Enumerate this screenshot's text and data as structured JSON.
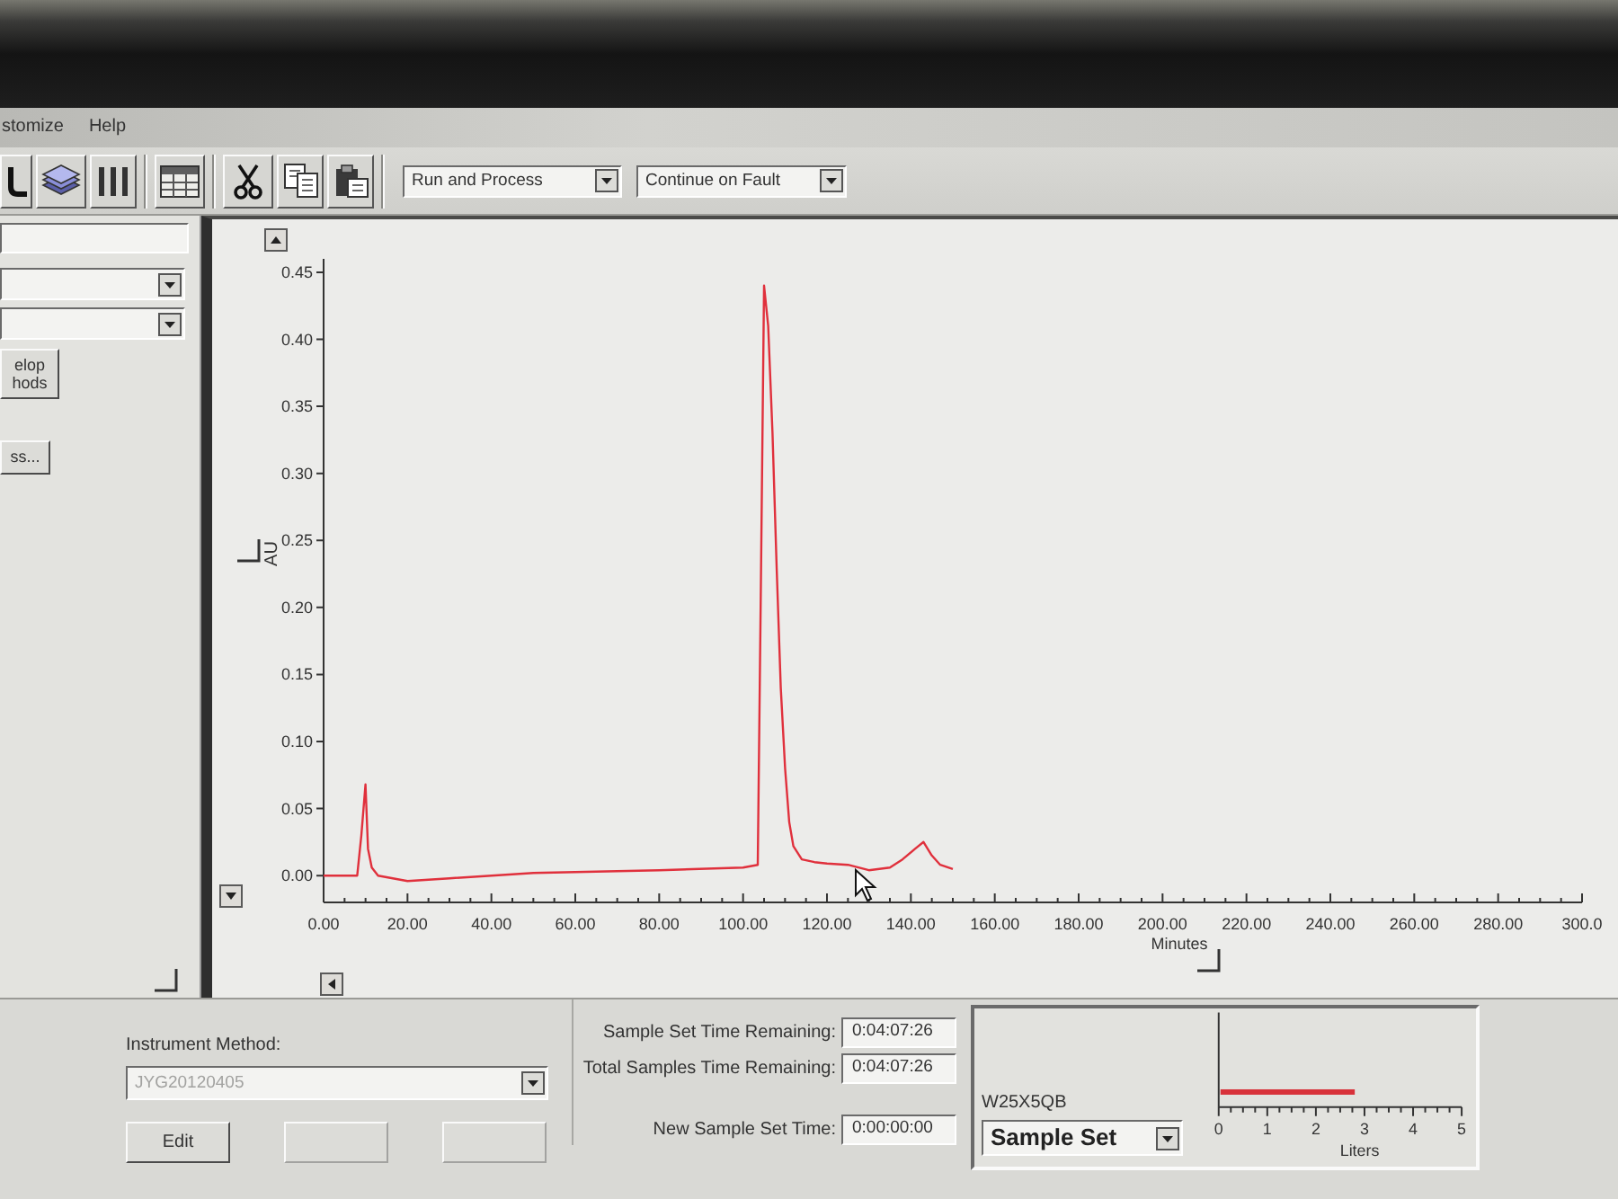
{
  "menu_bar": {
    "items": [
      "stomize",
      "Help"
    ]
  },
  "toolbar": {
    "run_mode": "Run and Process",
    "fault_mode": "Continue on Fault"
  },
  "side_panel": {
    "buttons": [
      "elop hods",
      "ss..."
    ]
  },
  "chart": {
    "chart_data": {
      "type": "line",
      "xlabel": "Minutes",
      "ylabel": "AU",
      "x": [
        0,
        8,
        9,
        10,
        10.6,
        11.5,
        13,
        20,
        30,
        50,
        80,
        100,
        103.5,
        104.2,
        105,
        106,
        107,
        108,
        109,
        110,
        111,
        112,
        114,
        117,
        120,
        125,
        130,
        135,
        138,
        141,
        143,
        145,
        147,
        150
      ],
      "values": [
        0.0,
        0.0,
        0.03,
        0.068,
        0.02,
        0.006,
        0.0,
        -0.004,
        -0.002,
        0.002,
        0.004,
        0.006,
        0.008,
        0.2,
        0.44,
        0.41,
        0.33,
        0.23,
        0.14,
        0.08,
        0.04,
        0.022,
        0.012,
        0.01,
        0.009,
        0.008,
        0.004,
        0.006,
        0.012,
        0.02,
        0.025,
        0.015,
        0.008,
        0.005
      ],
      "xlim": [
        0,
        300
      ],
      "ylim": [
        -0.02,
        0.46
      ],
      "xticks": [
        {
          "value": 0,
          "label": "0.00"
        },
        {
          "value": 20,
          "label": "20.00"
        },
        {
          "value": 40,
          "label": "40.00"
        },
        {
          "value": 60,
          "label": "60.00"
        },
        {
          "value": 80,
          "label": "80.00"
        },
        {
          "value": 100,
          "label": "100.00"
        },
        {
          "value": 120,
          "label": "120.00"
        },
        {
          "value": 140,
          "label": "140.00"
        },
        {
          "value": 160,
          "label": "160.00"
        },
        {
          "value": 180,
          "label": "180.00"
        },
        {
          "value": 200,
          "label": "200.00"
        },
        {
          "value": 220,
          "label": "220.00"
        },
        {
          "value": 240,
          "label": "240.00"
        },
        {
          "value": 260,
          "label": "260.00"
        },
        {
          "value": 280,
          "label": "280.00"
        },
        {
          "value": 300,
          "label": "300.0"
        }
      ],
      "yticks": [
        {
          "value": 0,
          "label": "0.00"
        },
        {
          "value": 0.05,
          "label": "0.05"
        },
        {
          "value": 0.1,
          "label": "0.10"
        },
        {
          "value": 0.15,
          "label": "0.15"
        },
        {
          "value": 0.2,
          "label": "0.20"
        },
        {
          "value": 0.25,
          "label": "0.25"
        },
        {
          "value": 0.3,
          "label": "0.30"
        },
        {
          "value": 0.35,
          "label": "0.35"
        },
        {
          "value": 0.4,
          "label": "0.40"
        },
        {
          "value": 0.45,
          "label": "0.45"
        }
      ]
    }
  },
  "instrument_method": {
    "label": "Instrument Method:",
    "value": "JYG20120405",
    "disabled": true,
    "buttons": [
      {
        "label": "Edit",
        "disabled": false
      },
      {
        "disabled": true
      },
      {
        "disabled": true
      }
    ]
  },
  "timing": [
    {
      "label": "Sample Set Time Remaining:",
      "value": "0:04:07:26"
    },
    {
      "label": "Total Samples Time Remaining:",
      "value": "0:04:07:26"
    },
    {
      "label": "New Sample Set Time:",
      "value": "0:00:00:00"
    }
  ],
  "solvent": {
    "label": "W25X5QB",
    "mode": "Sample Set",
    "chart_data": {
      "type": "bar",
      "orientation": "horizontal",
      "xlabel": "Liters",
      "values": [
        2.8
      ],
      "xlim": [
        0,
        5
      ],
      "xticks": [
        0,
        1,
        2,
        3,
        4,
        5
      ]
    }
  }
}
